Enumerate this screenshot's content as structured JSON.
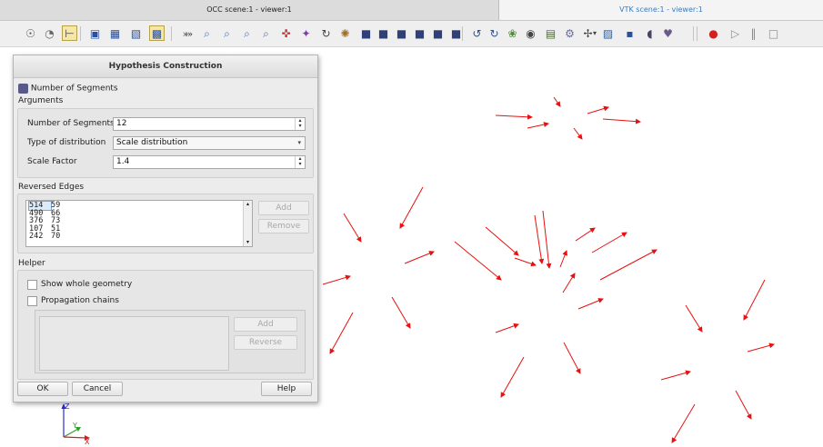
{
  "tabs": {
    "occ": "OCC scene:1 - viewer:1",
    "vtk": "VTK scene:1 - viewer:1"
  },
  "toolbar": {
    "items": [
      {
        "name": "dump-view-icon",
        "glyph": "☉",
        "color": "#555555"
      },
      {
        "name": "rotation-point-icon",
        "glyph": "◔",
        "color": "#666666"
      },
      {
        "name": "trihedron-icon",
        "glyph": "⊢",
        "color": "#444444"
      },
      {
        "name": "select-mode-icon",
        "glyph": "▣",
        "color": "#2a4f9e"
      },
      {
        "name": "select-rect-icon",
        "glyph": "▦",
        "color": "#2a4f9e"
      },
      {
        "name": "select-polygon-icon",
        "glyph": "▧",
        "color": "#2a4f9e"
      },
      {
        "name": "select-circle-icon",
        "glyph": "▩",
        "color": "#2a4f9e"
      },
      {
        "name": "fit-all-icon",
        "glyph": "⤘",
        "color": "#555555"
      },
      {
        "name": "fit-area-icon",
        "glyph": "⌕",
        "color": "#4a6fb3"
      },
      {
        "name": "fit-selection-icon",
        "glyph": "⌕",
        "color": "#4a6fb3"
      },
      {
        "name": "zoom-icon",
        "glyph": "⌕",
        "color": "#4a6fb3"
      },
      {
        "name": "zoom-out-icon",
        "glyph": "⌕",
        "color": "#4a6fb3"
      },
      {
        "name": "pan-icon",
        "glyph": "✜",
        "color": "#b23b3b"
      },
      {
        "name": "global-pan-icon",
        "glyph": "✦",
        "color": "#7a3fa0"
      },
      {
        "name": "rotate-icon",
        "glyph": "↻",
        "color": "#444444"
      },
      {
        "name": "spin-icon",
        "glyph": "✺",
        "color": "#a06f20"
      },
      {
        "name": "view-front-icon",
        "glyph": "■",
        "color": "#2f3f7a"
      },
      {
        "name": "view-back-icon",
        "glyph": "■",
        "color": "#2f3f7a"
      },
      {
        "name": "view-top-icon",
        "glyph": "■",
        "color": "#2f3f7a"
      },
      {
        "name": "view-bottom-icon",
        "glyph": "■",
        "color": "#2f3f7a"
      },
      {
        "name": "view-left-icon",
        "glyph": "■",
        "color": "#2f3f7a"
      },
      {
        "name": "view-right-icon",
        "glyph": "■",
        "color": "#2f3f7a"
      },
      {
        "name": "rotate-ccw-icon",
        "glyph": "↺",
        "color": "#2a4f9e"
      },
      {
        "name": "rotate-cw-icon",
        "glyph": "↻",
        "color": "#2a4f9e"
      },
      {
        "name": "reset-view-icon",
        "glyph": "❀",
        "color": "#4f8a3b"
      },
      {
        "name": "clone-view-icon",
        "glyph": "◉",
        "color": "#444444"
      },
      {
        "name": "clipping-icon",
        "glyph": "▤",
        "color": "#4a6f2a"
      },
      {
        "name": "scaling-icon",
        "glyph": "⚙",
        "color": "#6a6a9a"
      },
      {
        "name": "graduated-axes-icon",
        "glyph": "✢",
        "color": "#444444"
      },
      {
        "name": "ambient-icon",
        "glyph": "▨",
        "color": "#2f5f9e"
      },
      {
        "name": "projection-icon",
        "glyph": "▪",
        "color": "#2a4f9e"
      },
      {
        "name": "stereo-icon",
        "glyph": "◖",
        "color": "#444466"
      },
      {
        "name": "viewer-icon",
        "glyph": "♥",
        "color": "#6a5a8a"
      },
      {
        "name": "record-icon",
        "glyph": "●",
        "color": "#d42020"
      },
      {
        "name": "play-icon",
        "glyph": "▷",
        "color": "#8a8a8a"
      },
      {
        "name": "pause-icon",
        "glyph": "‖",
        "color": "#8a8a8a"
      },
      {
        "name": "stop-icon",
        "glyph": "□",
        "color": "#8a8a8a"
      }
    ],
    "dropdown_arrow": "▾"
  },
  "dialog": {
    "title": "Hypothesis Construction",
    "hypothesis_name": "Number of Segments",
    "arguments_label": "Arguments",
    "num_segments_label": "Number of Segments",
    "num_segments_value": "12",
    "distribution_label": "Type of distribution",
    "distribution_value": "Scale distribution",
    "scale_factor_label": "Scale Factor",
    "scale_factor_value": "1.4",
    "reversed_edges_label": "Reversed Edges",
    "edges": [
      [
        "514",
        "59"
      ],
      [
        "490",
        "66"
      ],
      [
        "376",
        "73"
      ],
      [
        "107",
        "51"
      ],
      [
        "242",
        "70"
      ]
    ],
    "add_label": "Add",
    "remove_label": "Remove",
    "helper_label": "Helper",
    "show_whole_geometry": "Show whole geometry",
    "propagation_chains": "Propagation chains",
    "helper_add_label": "Add",
    "reverse_label": "Reverse",
    "ok_label": "OK",
    "cancel_label": "Cancel",
    "help_label": "Help"
  },
  "axes": {
    "x": "X",
    "y": "Y",
    "z": "Z"
  },
  "colors": {
    "arrow": "#e81010",
    "accent_tab": "#3a7bbf"
  }
}
